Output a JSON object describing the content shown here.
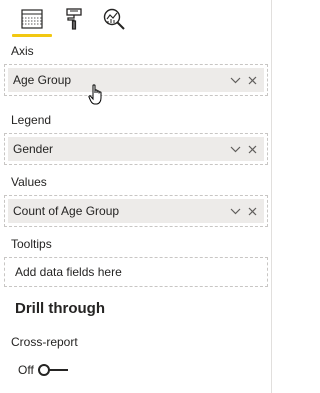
{
  "tabs": [
    {
      "name": "fields-tab",
      "icon": "table-grid-icon",
      "active": true
    },
    {
      "name": "format-tab",
      "icon": "paint-roller-icon",
      "active": false
    },
    {
      "name": "analytics-tab",
      "icon": "magnifier-chart-icon",
      "active": false
    }
  ],
  "wells": {
    "axis": {
      "label": "Axis",
      "field": "Age Group"
    },
    "legend": {
      "label": "Legend",
      "field": "Gender"
    },
    "values": {
      "label": "Values",
      "field": "Count of Age Group"
    },
    "tooltips": {
      "label": "Tooltips",
      "placeholder": "Add data fields here"
    }
  },
  "drill_through": {
    "heading": "Drill through",
    "cross_report_label": "Cross-report",
    "toggle_state": "Off"
  },
  "colors": {
    "accent": "#f2c811",
    "pill_background": "#edebe9",
    "text": "#252423",
    "well_border": "#c8c6c4"
  }
}
